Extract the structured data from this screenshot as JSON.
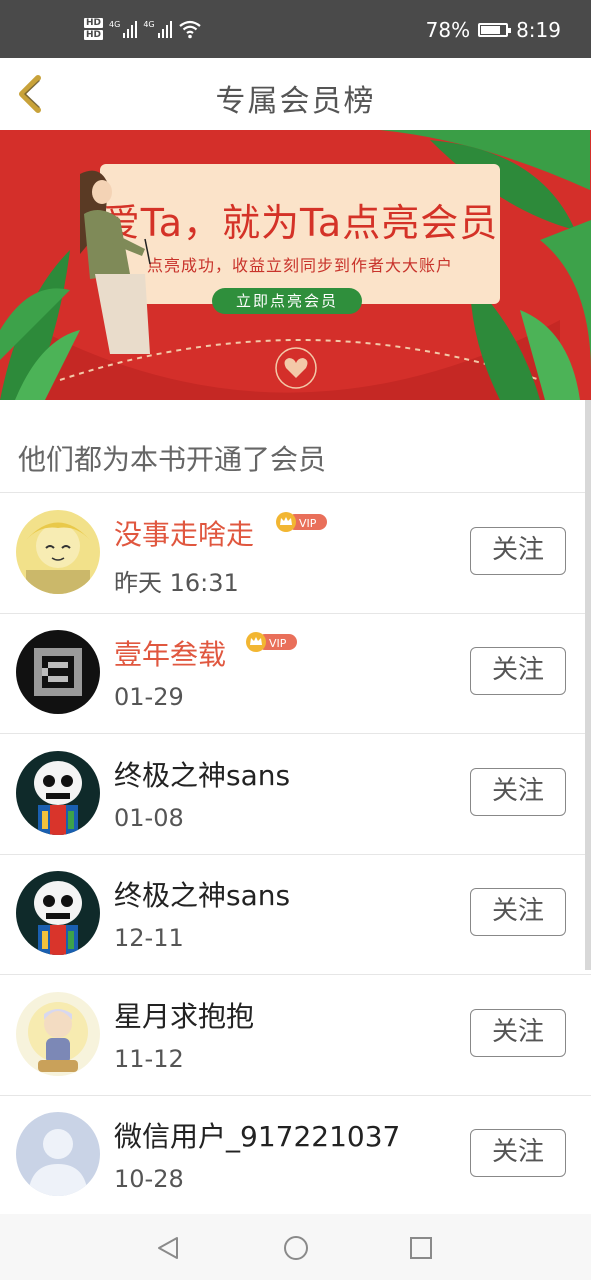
{
  "status_bar": {
    "hd1": "HD",
    "hd2": "HD",
    "net1": "4G",
    "net2": "4G",
    "battery": "78%",
    "battery_level": 0.78,
    "time": "8:19"
  },
  "header": {
    "title": "专属会员榜",
    "back_icon": "chevron-left-icon"
  },
  "banner": {
    "title": "爱Ta，就为Ta点亮会员",
    "subtitle": "点亮成功，收益立刻同步到作者大大账户",
    "button": "立即点亮会员"
  },
  "section": {
    "title": "他们都为本书开通了会员"
  },
  "members": [
    {
      "name": "没事走啥走",
      "vip": true,
      "vip_label": "VIP",
      "time": "昨天 16:31",
      "follow": "关注"
    },
    {
      "name": "壹年叁载",
      "vip": true,
      "vip_label": "VIP",
      "time": "01-29",
      "follow": "关注"
    },
    {
      "name": "终极之神sans",
      "vip": false,
      "time": "01-08",
      "follow": "关注"
    },
    {
      "name": "终极之神sans",
      "vip": false,
      "time": "12-11",
      "follow": "关注"
    },
    {
      "name": "星月求抱抱",
      "vip": false,
      "time": "11-12",
      "follow": "关注"
    },
    {
      "name": "微信用户_917221037",
      "vip": false,
      "time": "10-28",
      "follow": "关注"
    }
  ],
  "colors": {
    "accent": "#e0573f",
    "banner_red": "#d42f2a",
    "leaf_green": "#2f8f3c",
    "back_arrow": "#c8a23a"
  }
}
